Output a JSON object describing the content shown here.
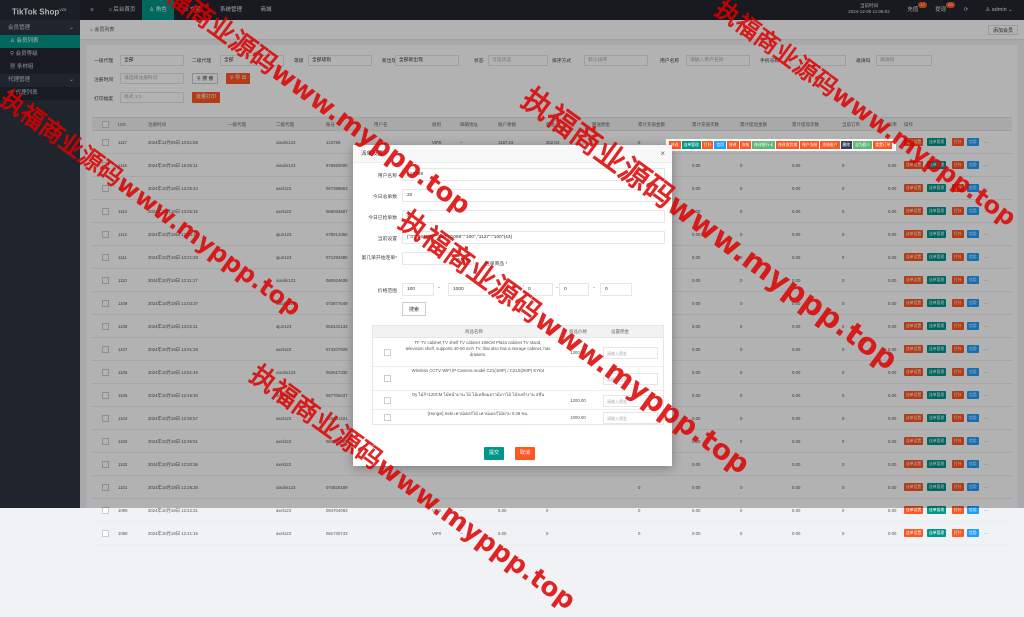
{
  "sidebar": {
    "logo": "TikTok Shop",
    "logo_ver": "V25",
    "groups": [
      {
        "label": "会员管理",
        "items": [
          "会员列表",
          "会员等级",
          "条材组"
        ]
      },
      {
        "label": "代理管理",
        "items": [
          "代理列表"
        ]
      }
    ]
  },
  "topbar": {
    "menu_icon": "≡",
    "tabs": [
      "后台首页",
      "角色",
      "交易",
      "系统管理",
      "商城"
    ],
    "clock_label": "当前时间",
    "clock_value": "2024-12-05 11:06:02",
    "recharge": "充值",
    "recharge_count": "17",
    "withdraw": "提现",
    "withdraw_count": "60",
    "user": "admin"
  },
  "tabbar": {
    "current": "会员列表",
    "add_button": "添加会员"
  },
  "filters": {
    "agent1_label": "一级代理",
    "agent1_value": "全部",
    "agent2_label": "二级代理",
    "agent2_value": "全部",
    "level_label": "等级",
    "level_value": "全部级别",
    "status_label": "新出现",
    "status_value": "全部新出现",
    "state_label": "状态",
    "state_placeholder": "可选状态",
    "sort_label": "排序方式",
    "sort_placeholder": "默认排序",
    "username_label": "用户名称",
    "username_placeholder": "请输入用户名称",
    "phone_label": "手机号码",
    "phone_placeholder": "",
    "invite_label": "邀请码",
    "invite_placeholder": "邀请码",
    "regtime_label": "注册时间",
    "regtime_placeholder": "请选择注册时间",
    "search_button": "搜 索",
    "export_button": "导 出",
    "print_label": "打印幅度",
    "print_placeholder": "格式 1:1",
    "print_button": "批量打印"
  },
  "table": {
    "headers": [
      "UID",
      "注册时间",
      "一级代理",
      "二级代理",
      "账号",
      "用户名",
      "级别",
      "邮箱地址",
      "账户余额",
      "佣金",
      "赠送佣金",
      "累计充值金额",
      "累计充值次数",
      "累计提现金额",
      "累计提现次数",
      "当前订单",
      "利率",
      "操作"
    ],
    "rows": [
      {
        "uid": "1117",
        "time": "2024年12月05日 10:51:59",
        "agent1": "",
        "agent2": "xiaolin123",
        "account": "123789",
        "name": "",
        "level": "VIP0",
        "mail": "--",
        "balance": "1157.24",
        "comm": "202.04",
        "gift": "",
        "rate": ""
      },
      {
        "uid": "1115",
        "time": "2024年10月18日 15:35:11",
        "agent1": "",
        "agent2": "xiaolin123",
        "account": "976850000",
        "name": "",
        "level": "",
        "mail": "",
        "balance": "",
        "comm": "",
        "gift": "",
        "rate": "0.00"
      },
      {
        "uid": "1114",
        "time": "2024年10月18日 13:25:44",
        "agent1": "",
        "agent2": "axel123",
        "account": "067388653",
        "name": "",
        "level": "",
        "mail": "",
        "balance": "",
        "comm": "",
        "gift": "",
        "rate": "0.00"
      },
      {
        "uid": "1113",
        "time": "2024年10月18日 13:25:15",
        "agent1": "",
        "agent2": "axel123",
        "account": "066034597",
        "name": "",
        "level": "",
        "mail": "",
        "balance": "",
        "comm": "",
        "gift": "",
        "rate": "0.00"
      },
      {
        "uid": "1112",
        "time": "2024年10月18日 13:23:11",
        "agent1": "",
        "agent2": "ajun123",
        "account": "075014350",
        "name": "",
        "level": "",
        "mail": "",
        "balance": "",
        "comm": "",
        "gift": "",
        "rate": "0.00"
      },
      {
        "uid": "1111",
        "time": "2024年10月18日 13:21:28",
        "agent1": "",
        "agent2": "ajun123",
        "account": "071294390",
        "name": "",
        "level": "",
        "mail": "",
        "balance": "",
        "comm": "",
        "gift": "",
        "rate": "0.00"
      },
      {
        "uid": "1110",
        "time": "2024年10月18日 13:11:17",
        "agent1": "",
        "agent2": "xiaolin123",
        "account": "060924639",
        "name": "",
        "level": "",
        "mail": "",
        "balance": "",
        "comm": "",
        "gift": "",
        "rate": "0.00"
      },
      {
        "uid": "1109",
        "time": "2024年10月18日 13:03:37",
        "agent1": "",
        "agent2": "xiaolin123",
        "account": "073877049",
        "name": "",
        "level": "",
        "mail": "",
        "balance": "",
        "comm": "",
        "gift": "",
        "rate": "0.00"
      },
      {
        "uid": "1108",
        "time": "2024年10月18日 13:02:11",
        "agent1": "",
        "agent2": "ajun123",
        "account": "062442133",
        "name": "",
        "level": "",
        "mail": "",
        "balance": "",
        "comm": "",
        "gift": "",
        "rate": "0.00"
      },
      {
        "uid": "1107",
        "time": "2024年10月18日 13:01:29",
        "agent1": "",
        "agent2": "axel123",
        "account": "074207829",
        "name": "",
        "level": "",
        "mail": "",
        "balance": "",
        "comm": "",
        "gift": "",
        "rate": "0.00"
      },
      {
        "uid": "1106",
        "time": "2024年10月18日 12:51:46",
        "agent1": "",
        "agent2": "xiaolin123",
        "account": "062617330",
        "name": "",
        "level": "",
        "mail": "",
        "balance": "",
        "comm": "",
        "gift": "",
        "rate": "0.00"
      },
      {
        "uid": "1105",
        "time": "2024年10月18日 12:46:30",
        "agent1": "",
        "agent2": "xiaolin123",
        "account": "067706437",
        "name": "",
        "level": "",
        "mail": "",
        "balance": "",
        "comm": "",
        "gift": "",
        "rate": "0.00"
      },
      {
        "uid": "1104",
        "time": "2024年10月18日 12:36:57",
        "agent1": "",
        "agent2": "axel123",
        "account": "065251221",
        "name": "",
        "level": "",
        "mail": "",
        "balance": "",
        "comm": "",
        "gift": "",
        "rate": "0.00"
      },
      {
        "uid": "1103",
        "time": "2024年10月18日 12:35:01",
        "agent1": "",
        "agent2": "axel123",
        "account": "084039726",
        "name": "",
        "level": "",
        "mail": "",
        "balance": "",
        "comm": "",
        "gift": "",
        "rate": "0.00"
      },
      {
        "uid": "1102",
        "time": "2024年10月18日 12:30:36",
        "agent1": "",
        "agent2": "axel123",
        "account": "",
        "name": "",
        "level": "",
        "mail": "",
        "balance": "",
        "comm": "",
        "gift": "",
        "rate": "0.00"
      },
      {
        "uid": "1101",
        "time": "2024年10月18日 12:28:28",
        "agent1": "",
        "agent2": "xiaolin123",
        "account": "074820189",
        "name": "",
        "level": "",
        "mail": "",
        "balance": "",
        "comm": "",
        "gift": "",
        "rate": "0.00"
      },
      {
        "uid": "1099",
        "time": "2024年10月18日 12:22:31",
        "agent1": "",
        "agent2": "axel123",
        "account": "084704093",
        "name": "",
        "level": "VIP0",
        "mail": "--",
        "balance": "5.00",
        "comm": "0",
        "gift": "",
        "rate": "0.00"
      },
      {
        "uid": "1098",
        "time": "2024年10月18日 12:21:15",
        "agent1": "",
        "agent2": "axel123",
        "account": "081730743",
        "name": "",
        "level": "VIP0",
        "mail": "--",
        "balance": "5.00",
        "comm": "0",
        "gift": "",
        "rate": "0.00"
      }
    ],
    "row_actions": [
      "连单设置",
      "连单管理",
      "打针",
      "信用"
    ],
    "more": "···",
    "bignums": [
      "0",
      "0.00",
      "0",
      "0.00",
      "0"
    ]
  },
  "header_actions": [
    "修改",
    "连单管理",
    "打针",
    "信用",
    "修改",
    "冻结",
    "修改银行卡",
    "修改收货地",
    "账户冻结",
    "冻结账户",
    "删除",
    "设为假人",
    "重置订单"
  ],
  "modal": {
    "title": "派单设置",
    "close": "×",
    "username_label": "用户名称",
    "username_value": "123789",
    "total_label": "今日总单数",
    "total_value": "20",
    "done_label": "今日已抢单数",
    "done_value": "4",
    "current_label": "当前设置",
    "current_value": "{\"3\":\"864\",\"4\":\"100\",\"1096\":\"100\",\"1127\":\"100\"}43}",
    "nth_label": "第几单开始连单",
    "continue_label": "连续数",
    "goods_label": "连单商品",
    "price_label": "价格范围",
    "price_min": "100",
    "price_max": "1000",
    "v3": "0",
    "v4": "0",
    "v5": "0",
    "search_button": "搜索",
    "goods_headers": [
      "商品名称",
      "商品价格",
      "设置佣金"
    ],
    "goods": [
      {
        "name": "TF TV cabinet TV shelf TV cabinet 190CM Plaza cabinet TV stand, television shelf, supports 40-50 inch TV, that also has a storage cabinet, has drawers.",
        "price": "1300.00",
        "placeholder": "请输入佣金"
      },
      {
        "name": "Wireless CCTV WiFi IP Camera model C21(1MP) / C21S(2MP) EYE4",
        "price": "",
        "placeholder": "请输入佣金"
      },
      {
        "name": "Oy ไม้ก้า120CM ไม้หน้าบาน ไม้ ไม้เหลี่ยมยาวมีเกาไม้ ไม้ลงทำงาน 2ชั้น",
        "price": "1200.00",
        "placeholder": "请输入佣金"
      },
      {
        "name": "[Hongxi] Seki เคาน์เตอร์ไม้ เคาน์เตอร์ไม้ผ่าบ 0.38 ซม.",
        "price": "1000.00",
        "placeholder": "请输入佣金"
      }
    ],
    "submit": "提交",
    "cancel": "取消"
  },
  "watermark": "执福商业源码www.myppp.top",
  "colors": {
    "teal": "#009688",
    "orange": "#ff5722",
    "red": "#ff5722",
    "green": "#5fb878",
    "blue": "#1e9fff",
    "dark": "#2e3440"
  }
}
